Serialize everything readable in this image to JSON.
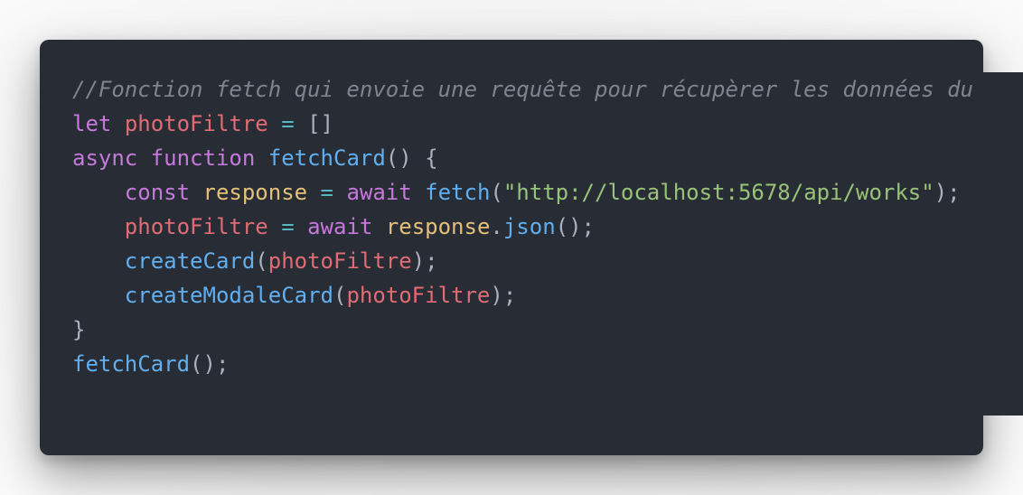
{
  "code_block": {
    "language": "javascript",
    "theme_colors": {
      "background": "#282c34",
      "comment": "#7f848e",
      "keyword": "#c678dd",
      "variable": "#e06c75",
      "function": "#61afef",
      "object": "#e5c07b",
      "string": "#98c379",
      "punctuation": "#abb2bf",
      "operator": "#56b6c2"
    },
    "lines": [
      {
        "tokens": [
          {
            "type": "cm",
            "text": "//Fonction fetch qui envoie une requête pour récupèrer les données du"
          }
        ]
      },
      {
        "tokens": [
          {
            "type": "kw",
            "text": "let"
          },
          {
            "type": "pun",
            "text": " "
          },
          {
            "type": "var",
            "text": "photoFiltre"
          },
          {
            "type": "pun",
            "text": " "
          },
          {
            "type": "op",
            "text": "="
          },
          {
            "type": "pun",
            "text": " []"
          }
        ]
      },
      {
        "tokens": [
          {
            "type": "kw",
            "text": "async"
          },
          {
            "type": "pun",
            "text": " "
          },
          {
            "type": "kw",
            "text": "function"
          },
          {
            "type": "pun",
            "text": " "
          },
          {
            "type": "fn",
            "text": "fetchCard"
          },
          {
            "type": "pun",
            "text": "() {"
          }
        ]
      },
      {
        "tokens": [
          {
            "type": "pun",
            "text": "    "
          },
          {
            "type": "kw",
            "text": "const"
          },
          {
            "type": "pun",
            "text": " "
          },
          {
            "type": "obj",
            "text": "response"
          },
          {
            "type": "pun",
            "text": " "
          },
          {
            "type": "op",
            "text": "="
          },
          {
            "type": "pun",
            "text": " "
          },
          {
            "type": "kw",
            "text": "await"
          },
          {
            "type": "pun",
            "text": " "
          },
          {
            "type": "fn",
            "text": "fetch"
          },
          {
            "type": "pun",
            "text": "("
          },
          {
            "type": "str",
            "text": "\"http://localhost:5678/api/works\""
          },
          {
            "type": "pun",
            "text": ");"
          }
        ]
      },
      {
        "tokens": [
          {
            "type": "pun",
            "text": "    "
          },
          {
            "type": "var",
            "text": "photoFiltre"
          },
          {
            "type": "pun",
            "text": " "
          },
          {
            "type": "op",
            "text": "="
          },
          {
            "type": "pun",
            "text": " "
          },
          {
            "type": "kw",
            "text": "await"
          },
          {
            "type": "pun",
            "text": " "
          },
          {
            "type": "obj",
            "text": "response"
          },
          {
            "type": "pun",
            "text": "."
          },
          {
            "type": "fn",
            "text": "json"
          },
          {
            "type": "pun",
            "text": "();"
          }
        ]
      },
      {
        "tokens": [
          {
            "type": "pun",
            "text": "    "
          },
          {
            "type": "fn",
            "text": "createCard"
          },
          {
            "type": "pun",
            "text": "("
          },
          {
            "type": "var",
            "text": "photoFiltre"
          },
          {
            "type": "pun",
            "text": ");"
          }
        ]
      },
      {
        "tokens": [
          {
            "type": "pun",
            "text": "    "
          },
          {
            "type": "fn",
            "text": "createModaleCard"
          },
          {
            "type": "pun",
            "text": "("
          },
          {
            "type": "var",
            "text": "photoFiltre"
          },
          {
            "type": "pun",
            "text": ");"
          }
        ]
      },
      {
        "tokens": [
          {
            "type": "pun",
            "text": "}"
          }
        ]
      },
      {
        "tokens": [
          {
            "type": "fn",
            "text": "fetchCard"
          },
          {
            "type": "pun",
            "text": "();"
          }
        ]
      }
    ]
  }
}
